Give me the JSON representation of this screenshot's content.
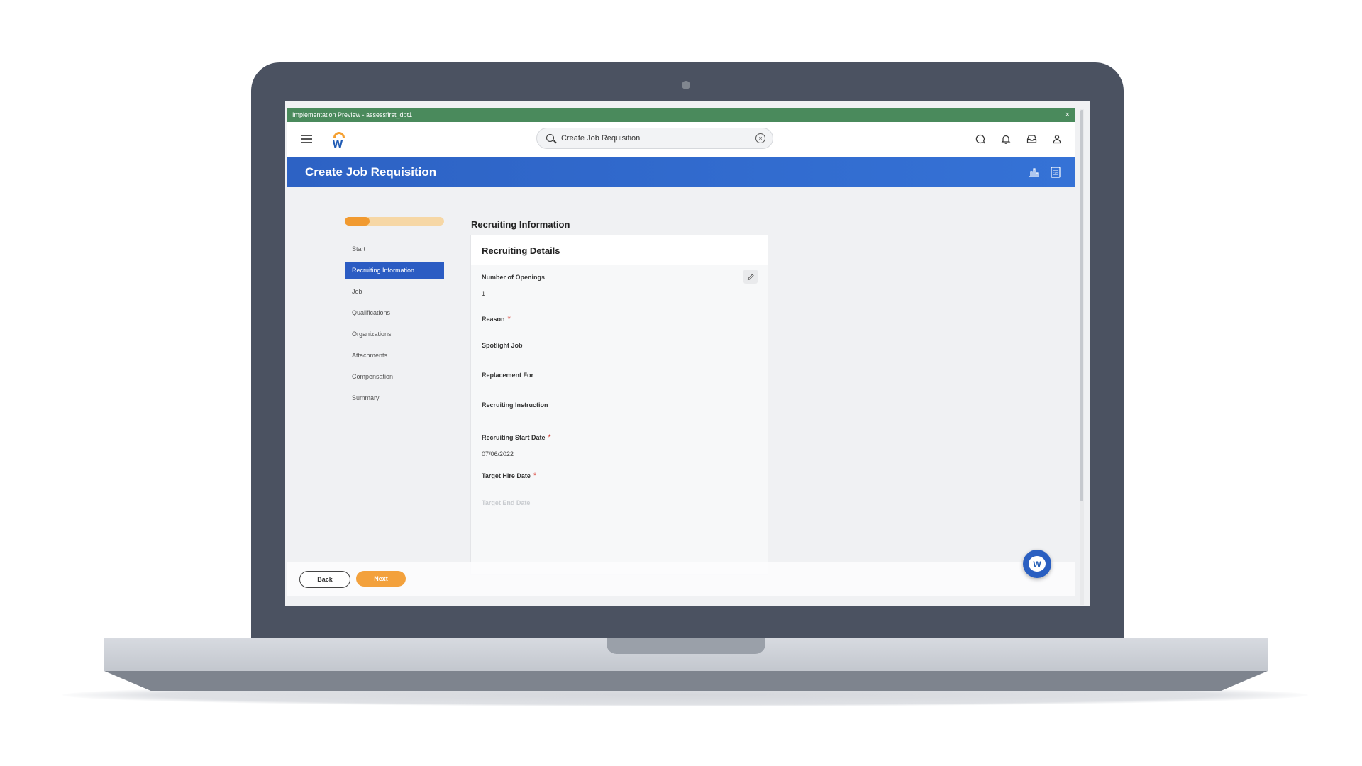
{
  "banner": {
    "text": "Implementation Preview - assessfirst_dpt1",
    "close": "×"
  },
  "search": {
    "query": "Create Job Requisition",
    "clear": "×"
  },
  "header": {
    "title": "Create Job Requisition"
  },
  "progress": {
    "fraction": 0.25
  },
  "steps": [
    {
      "label": "Start"
    },
    {
      "label": "Recruiting Information"
    },
    {
      "label": "Job"
    },
    {
      "label": "Qualifications"
    },
    {
      "label": "Organizations"
    },
    {
      "label": "Attachments"
    },
    {
      "label": "Compensation"
    },
    {
      "label": "Summary"
    }
  ],
  "section": {
    "title": "Recruiting Information"
  },
  "card": {
    "title": "Recruiting Details",
    "fields": [
      {
        "label": "Number of Openings",
        "value": "1"
      },
      {
        "label": "Reason",
        "required": "*"
      },
      {
        "label": "Spotlight Job"
      },
      {
        "label": "Replacement For"
      },
      {
        "label": "Recruiting Instruction"
      },
      {
        "label": "Recruiting Start Date",
        "required": "*",
        "value": "07/06/2022"
      },
      {
        "label": "Target Hire Date",
        "required": "*"
      },
      {
        "label": "Target End Date"
      }
    ]
  },
  "footer": {
    "back": "Back",
    "next": "Next"
  },
  "assistant": {
    "glyph": "W"
  },
  "colors": {
    "brand": "#2d62c4",
    "accent": "#f19a30",
    "preview_bar": "#4a8a5c",
    "required": "#d9382e"
  }
}
